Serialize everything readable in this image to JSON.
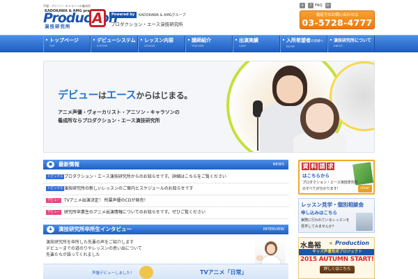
{
  "header": {
    "tagline": "声優・アニソン・キャラソンの養成所",
    "logo_small": "KADOKAWA & AMG presents",
    "logo_main": "Production",
    "logo_a": "A",
    "logo_sub": "演技研究所",
    "powered_badge": "Powered by",
    "powered_group": "KADOKAWA & AMGグループ",
    "institute_name": "プロダクション・エース演技研究所",
    "util_links": [
      {
        "icon": "map-icon",
        "label": ""
      },
      {
        "icon": "help-icon",
        "label": "FAQ"
      },
      {
        "icon": "mail-icon",
        "label": ""
      }
    ],
    "phone_label": "電話でのお問い合わせは",
    "phone_number": "03-5728-4777"
  },
  "nav": {
    "items": [
      {
        "label": "トップページ",
        "sub": "TOP"
      },
      {
        "label": "デビューシステム",
        "sub": "SYSTEM"
      },
      {
        "label": "レッスン内容",
        "sub": "LESSON"
      },
      {
        "label": "講師紹介",
        "sub": "TEACHER"
      },
      {
        "label": "出演実績",
        "sub": "CASE"
      },
      {
        "label": "入所希望者",
        "sub": "ENTRY"
      },
      {
        "label": "演技研究所について",
        "sub": "ABOUT"
      }
    ],
    "entry_suffix": "の皆様へ"
  },
  "hero": {
    "tagline_part1": "デビュー",
    "tagline_part2": "は",
    "tagline_part3": "エース",
    "tagline_part4": "からはじまる。",
    "desc1": "アニメ声優・ヴォーカリスト・アニソン・キャラソンの",
    "desc2": "養成所ならプロダクション・エース演技研究所"
  },
  "news": {
    "title": "最新情報",
    "en": "NEWS",
    "items": [
      {
        "tag": "トピックス",
        "tag_color": "#2f6fd0",
        "text": "プロダクション・エース演技研究所からのお知らせです。詳細はこちらをご覧ください"
      },
      {
        "tag": "トピックス",
        "tag_color": "#2f6fd0",
        "text": "演技研究所の新しいレッスンのご案内とスケジュールのお知らせです"
      },
      {
        "tag": "デビュー",
        "tag_color": "#e2477a",
        "text": "TVアニメ出演決定！ 所属声優のCDが発売！"
      },
      {
        "tag": "デビュー",
        "tag_color": "#e2477a",
        "text": "研究所卒業生のアニメ出演情報についてのお知らせです。ぜひご覧ください"
      }
    ]
  },
  "interview": {
    "title": "演技研究所卒所生インタビュー",
    "en": "INTERVIEW",
    "lines": [
      "演技研究所を卒所した先輩の声をご紹介します",
      "デビューまでの道のりやレッスンの思い出について",
      "先輩たちが語ってくれました"
    ]
  },
  "bottom_strip": {
    "text1": "声優デビューしました！",
    "text2": "TVアニメ「日常」"
  },
  "sidebar": {
    "doc": {
      "chars": [
        "資",
        "料",
        "請",
        "求"
      ],
      "line1": "はこちらから",
      "line2": "プロダクション・エース演技研究所",
      "line3": "のすべてが分かります！",
      "click": "click!"
    },
    "trial": {
      "title": "レッスン見学・個別相談会",
      "sub": "申し込みはこちら",
      "desc1": "実際に行われているレッスンを",
      "desc2": "見学してみませんか？"
    },
    "kids": {
      "name": "水島裕",
      "x": "×",
      "logo": "Production",
      "bar": "キッズ声優育成プロジェクト",
      "autumn": "2015 AUTUMN START!",
      "btn": "詳しくはこちら"
    }
  },
  "colors": {
    "brand_blue": "#1a55a8",
    "nav_blue": "#2f6fd0",
    "accent_orange": "#f29a24",
    "accent_red": "#cc1f2b"
  }
}
